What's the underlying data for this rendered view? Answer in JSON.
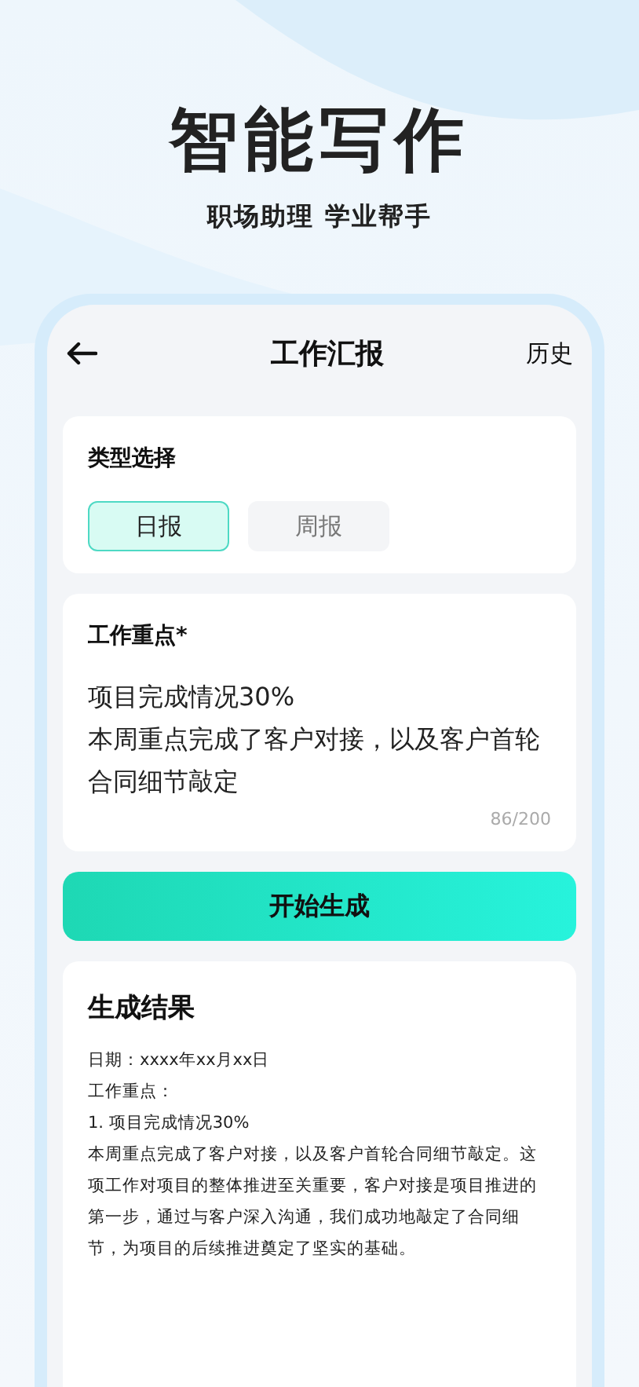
{
  "headline": "智能写作",
  "subtitle": "职场助理 学业帮手",
  "nav": {
    "title": "工作汇报",
    "action": "历史"
  },
  "type_card": {
    "label": "类型选择",
    "options": [
      {
        "label": "日报",
        "selected": true
      },
      {
        "label": "周报",
        "selected": false
      }
    ]
  },
  "focus_card": {
    "label": "工作重点*",
    "value": "项目完成情况30%\n本周重点完成了客户对接，以及客户首轮合同细节敲定",
    "counter": "86/200"
  },
  "generate_button": "开始生成",
  "result": {
    "title": "生成结果",
    "lines": [
      "日期：xxxx年xx月xx日",
      "工作重点：",
      "1. 项目完成情况30%",
      "本周重点完成了客户对接，以及客户首轮合同细节敲定。这项工作对项目的整体推进至关重要，客户对接是项目推进的第一步，通过与客户深入沟通，我们成功地敲定了合同细节，为项目的后续推进奠定了坚实的基础。"
    ]
  }
}
